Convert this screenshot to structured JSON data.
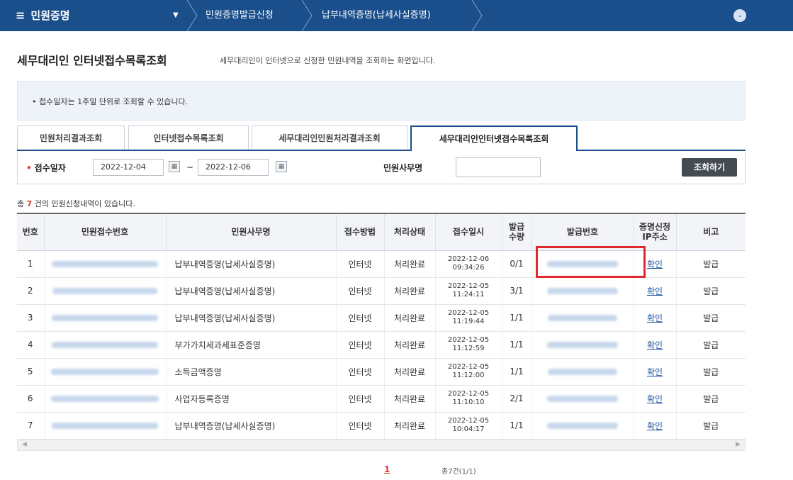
{
  "nav": {
    "menu_label": "민원증명",
    "dropdown_glyph": "▼",
    "crumb1": "민원증명발급신청",
    "crumb2": "납부내역증명(납세사실증명)",
    "circle_glyph": "⌄",
    "menu_glyph": "≡"
  },
  "heading": {
    "title": "세무대리인 인터넷접수목록조회",
    "desc": "세무대리인이 인터넷으로 신청한 민원내역을 조회하는 화면입니다."
  },
  "info": "• 접수일자는 1주일 단위로 조회할 수 있습니다.",
  "tabs": [
    {
      "label": "민원처리결과조회"
    },
    {
      "label": "인터넷접수목록조회"
    },
    {
      "label": "세무대리인민원처리결과조회"
    },
    {
      "label": "세무대리인인터넷접수목록조회"
    }
  ],
  "search": {
    "date_label": "접수일자",
    "required_mark": "•",
    "date_from": "2022-12-04",
    "tilde": "~",
    "date_to": "2022-12-06",
    "office_label": "민원사무명",
    "office_value": "",
    "search_button": "조회하기",
    "calendar_glyph": "▦"
  },
  "count": {
    "prefix": "총 ",
    "num": "7",
    "suffix": " 건의 민원신청내역이 있습니다."
  },
  "table": {
    "headers": [
      "번호",
      "민원접수번호",
      "민원사무명",
      "접수방법",
      "처리상태",
      "접수일시",
      "발급\n수량",
      "발급번호",
      "증명신청\nIP주소",
      "비고"
    ],
    "rows": [
      {
        "no": "1",
        "name": "납부내역증명(납세사실증명)",
        "method": "인터넷",
        "status": "처리완료",
        "date": "2022-12-06",
        "time": "09:34:26",
        "qty": "0/1",
        "ip": "확인",
        "note": "발급"
      },
      {
        "no": "2",
        "name": "납부내역증명(납세사실증명)",
        "method": "인터넷",
        "status": "처리완료",
        "date": "2022-12-05",
        "time": "11:24:11",
        "qty": "3/1",
        "ip": "확인",
        "note": "발급"
      },
      {
        "no": "3",
        "name": "납부내역증명(납세사실증명)",
        "method": "인터넷",
        "status": "처리완료",
        "date": "2022-12-05",
        "time": "11:19:44",
        "qty": "1/1",
        "ip": "확인",
        "note": "발급"
      },
      {
        "no": "4",
        "name": "부가가치세과세표준증명",
        "method": "인터넷",
        "status": "처리완료",
        "date": "2022-12-05",
        "time": "11:12:59",
        "qty": "1/1",
        "ip": "확인",
        "note": "발급"
      },
      {
        "no": "5",
        "name": "소득금액증명",
        "method": "인터넷",
        "status": "처리완료",
        "date": "2022-12-05",
        "time": "11:12:00",
        "qty": "1/1",
        "ip": "확인",
        "note": "발급"
      },
      {
        "no": "6",
        "name": "사업자등록증명",
        "method": "인터넷",
        "status": "처리완료",
        "date": "2022-12-05",
        "time": "11:10:10",
        "qty": "2/1",
        "ip": "확인",
        "note": "발급"
      },
      {
        "no": "7",
        "name": "납부내역증명(납세사실증명)",
        "method": "인터넷",
        "status": "처리완료",
        "date": "2022-12-05",
        "time": "10:04:17",
        "qty": "1/1",
        "ip": "확인",
        "note": "발급"
      }
    ]
  },
  "scroll": {
    "left": "◀",
    "right": "▶"
  },
  "pager": {
    "current": "1",
    "total": "총7건(1/1)"
  },
  "colors": {
    "nav": "#1a4f8c",
    "highlight": "#e0282e",
    "count": "#d43a2f"
  }
}
